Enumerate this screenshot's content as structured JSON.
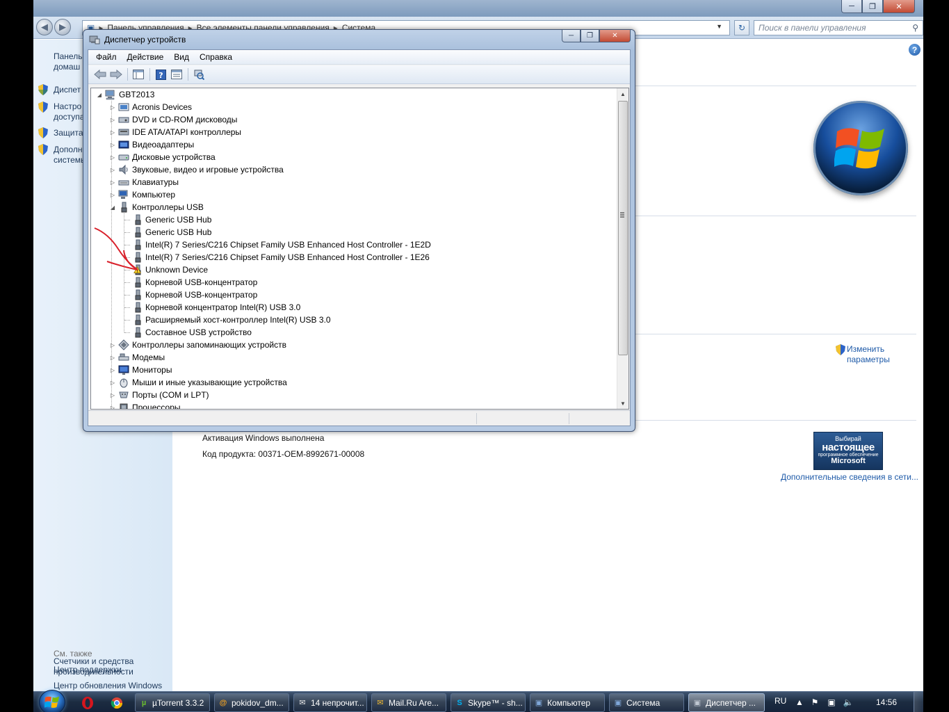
{
  "explorer": {
    "breadcrumb": [
      "Панель управления",
      "Все элементы панели управления",
      "Система"
    ],
    "search_placeholder": "Поиск в панели управления",
    "sidebar": {
      "items": [
        {
          "label": "Панель управления — домашняя страница",
          "line1": "Панель",
          "line2": "домаш"
        },
        {
          "label": "Диспетчер устройств",
          "line1": "Диспет",
          "line2": ""
        },
        {
          "label": "Настройка удаленного доступа",
          "line1": "Настро",
          "line2": "доступа"
        },
        {
          "label": "Защита системы",
          "line1": "Защита",
          "line2": ""
        },
        {
          "label": "Дополнительные параметры системы",
          "line1": "Дополн",
          "line2": "системы"
        }
      ],
      "see_also": "См. также",
      "bottom_links": [
        "Центр поддержки",
        "Центр обновления Windows"
      ],
      "perf_line1": "Счетчики и средства",
      "perf_line2": "производительности"
    },
    "change_params_line1": "Изменить",
    "change_params_line2": "параметры",
    "activation": "Активация Windows выполнена",
    "product_key": "Код продукта:  00371-OEM-8992671-00008",
    "genuine_badge": {
      "line1": "Выбирай",
      "line2": "настоящее",
      "line3": "программное обеспечение",
      "line4": "Microsoft"
    },
    "more_online": "Дополнительные сведения в сети..."
  },
  "device_manager": {
    "title": "Диспетчер устройств",
    "menu": [
      "Файл",
      "Действие",
      "Вид",
      "Справка"
    ],
    "root": "GBT2013",
    "categories": [
      {
        "label": "Acronis Devices",
        "icon": "acronis-icon"
      },
      {
        "label": "DVD и CD-ROM дисководы",
        "icon": "dvd-icon"
      },
      {
        "label": "IDE ATA/ATAPI контроллеры",
        "icon": "ide-icon"
      },
      {
        "label": "Видеоадаптеры",
        "icon": "display-adapter-icon"
      },
      {
        "label": "Дисковые устройства",
        "icon": "disk-icon"
      },
      {
        "label": "Звуковые, видео и игровые устройства",
        "icon": "sound-icon"
      },
      {
        "label": "Клавиатуры",
        "icon": "keyboard-icon"
      },
      {
        "label": "Компьютер",
        "icon": "computer-icon"
      },
      {
        "label": "Контроллеры USB",
        "icon": "usb-icon"
      }
    ],
    "usb_children": [
      {
        "label": "Generic USB Hub",
        "warning": false
      },
      {
        "label": "Generic USB Hub",
        "warning": false
      },
      {
        "label": "Intel(R) 7 Series/C216 Chipset Family USB Enhanced Host Controller - 1E2D",
        "warning": false
      },
      {
        "label": "Intel(R) 7 Series/C216 Chipset Family USB Enhanced Host Controller - 1E26",
        "warning": false
      },
      {
        "label": "Unknown Device",
        "warning": true
      },
      {
        "label": "Корневой USB-концентратор",
        "warning": false
      },
      {
        "label": "Корневой USB-концентратор",
        "warning": false
      },
      {
        "label": "Корневой концентратор Intel(R) USB 3.0",
        "warning": false
      },
      {
        "label": "Расширяемый хост-контроллер Intel(R) USB 3.0",
        "warning": false
      },
      {
        "label": "Составное USB устройство",
        "warning": false
      }
    ],
    "after_categories": [
      {
        "label": "Контроллеры запоминающих устройств",
        "icon": "storage-controller-icon"
      },
      {
        "label": "Модемы",
        "icon": "modem-icon"
      },
      {
        "label": "Мониторы",
        "icon": "monitor-icon"
      },
      {
        "label": "Мыши и иные указывающие устройства",
        "icon": "mouse-icon"
      },
      {
        "label": "Порты (COM и LPT)",
        "icon": "port-icon"
      },
      {
        "label": "Процессоры",
        "icon": "processor-icon"
      }
    ]
  },
  "taskbar": {
    "tasks": [
      {
        "label": "µTorrent 3.3.2",
        "icon": "utorrent-icon"
      },
      {
        "label": "pokidov_dm...",
        "icon": "mailru-agent-icon"
      },
      {
        "label": "14 непрочит...",
        "icon": "mail-icon"
      },
      {
        "label": "Mail.Ru Are...",
        "icon": "mailru-icon"
      },
      {
        "label": "Skype™ - sh...",
        "icon": "skype-icon"
      },
      {
        "label": "Компьютер",
        "icon": "computer-icon"
      },
      {
        "label": "Система",
        "icon": "system-icon"
      },
      {
        "label": "Диспетчер ...",
        "icon": "device-manager-icon"
      }
    ],
    "lang": "RU",
    "clock": "14:56"
  }
}
